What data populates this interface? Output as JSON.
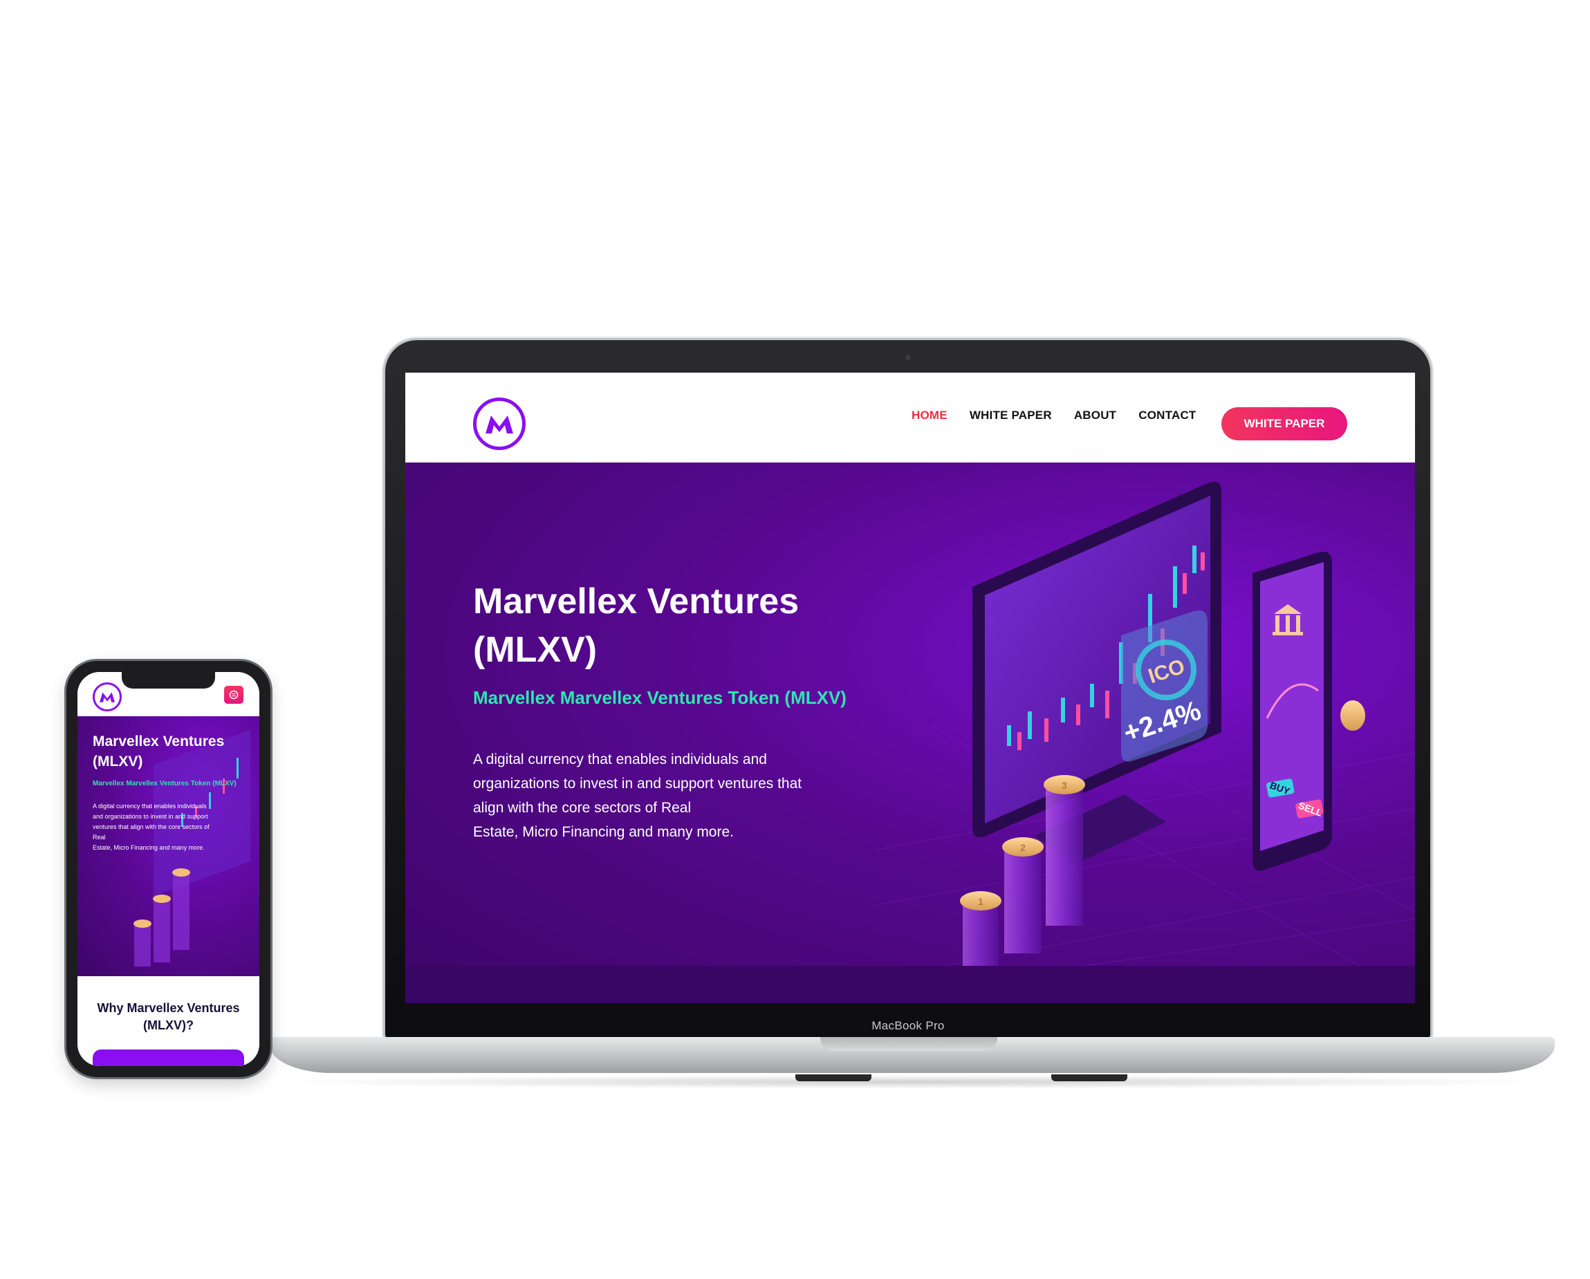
{
  "device": {
    "laptop_label": "MacBook Pro"
  },
  "site": {
    "nav": {
      "links": [
        "HOME",
        "WHITE PAPER",
        "ABOUT",
        "CONTACT"
      ],
      "active": "HOME",
      "cta": "WHITE PAPER"
    },
    "hero": {
      "title": "Marvellex Ventures (MLXV)",
      "subtitle": "Marvellex Marvellex Ventures Token (MLXV)",
      "description": "A digital currency that enables individuals and\norganizations to invest in and support ventures that\nalign with the core sectors of Real\nEstate, Micro Financing and many more."
    },
    "illustration": {
      "badge_label": "ICO",
      "badge_change": "+2.4%",
      "buy_label": "BUY",
      "sell_label": "SELL",
      "coin_numbers": [
        "1",
        "2",
        "3"
      ]
    }
  },
  "mobile": {
    "hero": {
      "title": "Marvellex Ventures (MLXV)",
      "subtitle": "Marvellex Marvellex Ventures Token (MLXV)",
      "description": "A digital currency that enables individuals\nand organizations to invest in and support\nventures that align with the core sectors of\nReal\nEstate, Micro Financing and many more."
    },
    "why_heading": "Why Marvellex Ventures (MLXV)?"
  },
  "colors": {
    "brand_purple": "#8a0ff0",
    "nav_active": "#ee2d3c",
    "cta_gradient": [
      "#f2365d",
      "#e9167f"
    ],
    "accent_teal": "#2ee6b0",
    "hero_bg": "#57088f"
  },
  "icons": [
    "logo-m-icon",
    "hamburger-menu-icon",
    "bank-icon",
    "coin-icon"
  ]
}
